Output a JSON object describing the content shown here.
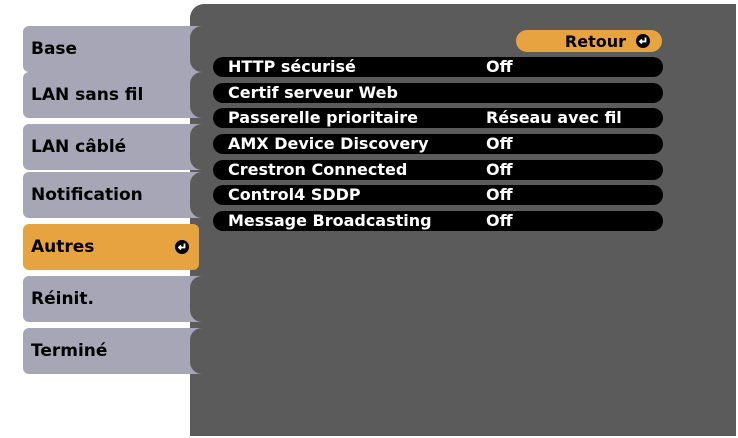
{
  "sidebar": {
    "tabs": [
      {
        "label": "Base"
      },
      {
        "label": "LAN sans fil"
      },
      {
        "label": "LAN câblé"
      },
      {
        "label": "Notification"
      },
      {
        "label": "Autres"
      },
      {
        "label": "Réinit."
      },
      {
        "label": "Terminé"
      }
    ]
  },
  "main": {
    "back_label": "Retour",
    "rows": [
      {
        "name": "HTTP sécurisé",
        "value": "Off"
      },
      {
        "name": "Certif serveur Web",
        "value": ""
      },
      {
        "name": "Passerelle prioritaire",
        "value": "Réseau avec fil"
      },
      {
        "name": "AMX Device Discovery",
        "value": "Off"
      },
      {
        "name": "Crestron Connected",
        "value": "Off"
      },
      {
        "name": "Control4 SDDP",
        "value": "Off"
      },
      {
        "name": "Message Broadcasting",
        "value": "Off"
      }
    ]
  },
  "colors": {
    "tab_default": "#a6a6b6",
    "tab_active": "#e8a341",
    "panel": "#5b5b5b",
    "row": "#000000"
  },
  "icons": {
    "enter": "enter-icon"
  }
}
